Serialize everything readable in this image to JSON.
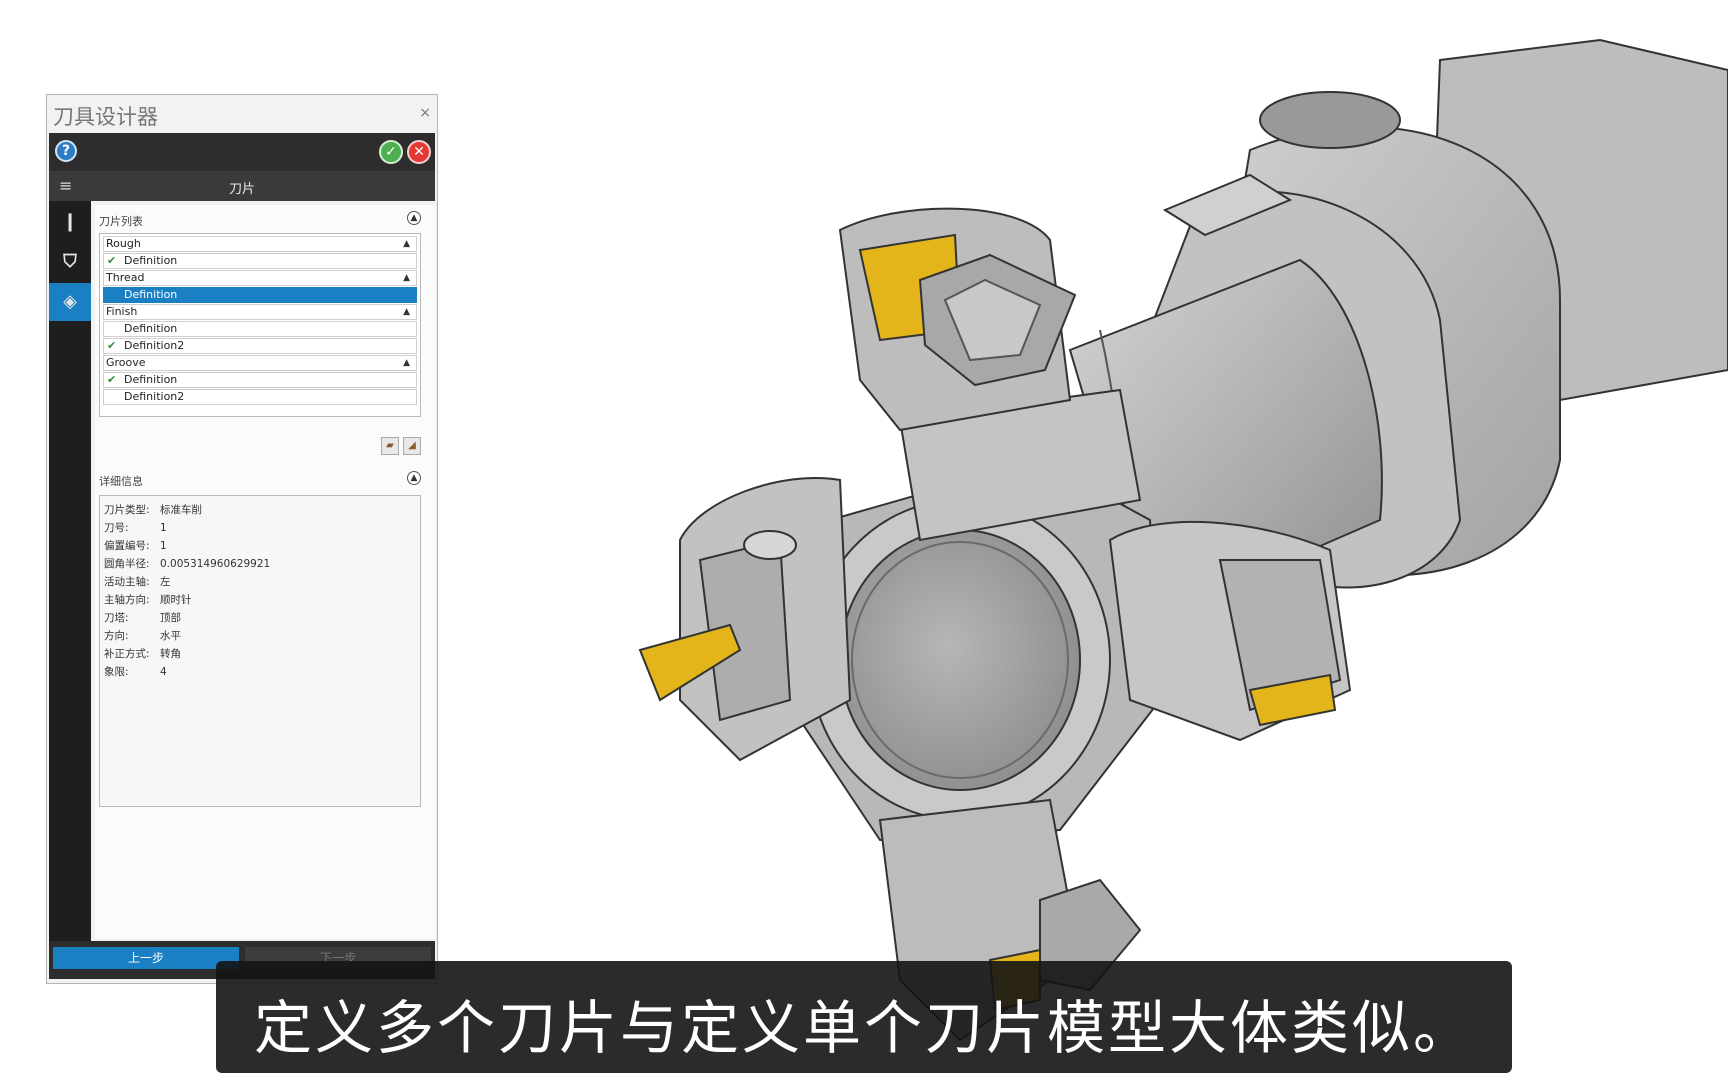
{
  "dialog": {
    "title": "刀具设计器",
    "close_label": "×",
    "help_label": "?",
    "ok_label": "✓",
    "cancel_label": "✕",
    "section_title": "刀片",
    "insert_list_label": "刀片列表",
    "detail_label": "详细信息",
    "tree": [
      {
        "label": "Rough",
        "type": "group"
      },
      {
        "label": "Definition",
        "type": "child",
        "checked": true
      },
      {
        "label": "Thread",
        "type": "group"
      },
      {
        "label": "Definition",
        "type": "child",
        "selected": true
      },
      {
        "label": "Finish",
        "type": "group"
      },
      {
        "label": "Definition",
        "type": "child"
      },
      {
        "label": "Definition2",
        "type": "child",
        "checked": true
      },
      {
        "label": "Groove",
        "type": "group"
      },
      {
        "label": "Definition",
        "type": "child",
        "checked": true
      },
      {
        "label": "Definition2",
        "type": "child"
      }
    ],
    "details": [
      {
        "key": "刀片类型:",
        "value": "标准车削"
      },
      {
        "key": "刀号:",
        "value": "1"
      },
      {
        "key": "偏置编号:",
        "value": "1"
      },
      {
        "key": "圆角半径:",
        "value": "0.005314960629921"
      },
      {
        "key": "活动主轴:",
        "value": "左"
      },
      {
        "key": "主轴方向:",
        "value": "顺时针"
      },
      {
        "key": "刀塔:",
        "value": "顶部"
      },
      {
        "key": "方向:",
        "value": "水平"
      },
      {
        "key": "补正方式:",
        "value": "转角"
      },
      {
        "key": "象限:",
        "value": "4"
      }
    ],
    "prev_label": "上一步",
    "next_label": "下一步"
  },
  "subtitle": "定义多个刀片与定义单个刀片模型大体类似。",
  "colors": {
    "accent": "#1b7fc4",
    "panel_dark": "#2d2d2d",
    "insert_gold": "#e3b51b",
    "tool_gray": "#b9b9b9"
  }
}
